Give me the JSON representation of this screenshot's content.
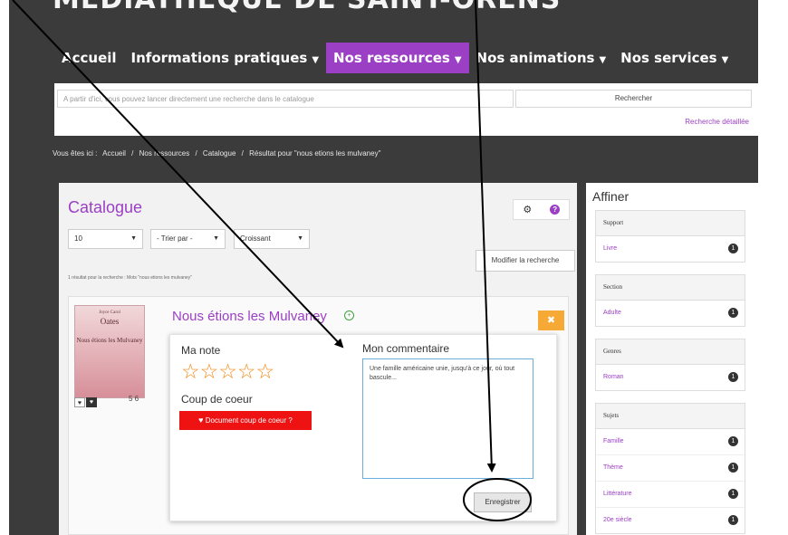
{
  "site": {
    "title": "MÉDIATHÈQUE DE SAINT-ORENS"
  },
  "nav": {
    "items": [
      {
        "label": "Accueil"
      },
      {
        "label": "Informations pratiques"
      },
      {
        "label": "Nos ressources"
      },
      {
        "label": "Nos animations"
      },
      {
        "label": "Nos services"
      }
    ],
    "caret": "▼"
  },
  "search": {
    "placeholder": "A partir d'ici, vous pouvez lancer directement une recherche dans le catalogue",
    "button_label": "Rechercher",
    "advanced_link": "Recherche détaillée"
  },
  "breadcrumb": {
    "prefix": "Vous êtes ici :",
    "items": [
      "Accueil",
      "Nos ressources",
      "Catalogue",
      "Résultat pour \"nous etions les mulvaney\""
    ],
    "separator": "/"
  },
  "catalogue": {
    "title": "Catalogue",
    "per_page": "10",
    "sort": "- Trier par -",
    "order": "Croissant",
    "modify_button": "Modifier la recherche",
    "results_text": "1 résultat pour la recherche : Mots \"nous etions les mulvaney\""
  },
  "result": {
    "title": "Nous étions les Mulvaney",
    "book_author_first": "Joyce Carol",
    "book_author_last": "Oates",
    "book_title": "Nous étions les Mulvaney",
    "year": "5 6"
  },
  "popup": {
    "rating_label": "Ma note",
    "stars": "☆☆☆☆☆",
    "favorite_label": "Coup de coeur",
    "favorite_button": "Document coup de coeur ?",
    "comment_label": "Mon commentaire",
    "comment_text": "Une famille américaine unie, jusqu'à ce jour, où tout bascule...",
    "save_button": "Enregistrer"
  },
  "refine": {
    "title": "Affiner",
    "facets": [
      {
        "heading": "Support",
        "items": [
          {
            "label": "Livre",
            "count": "1"
          }
        ]
      },
      {
        "heading": "Section",
        "items": [
          {
            "label": "Adulte",
            "count": "1"
          }
        ]
      },
      {
        "heading": "Genres",
        "items": [
          {
            "label": "Roman",
            "count": "1"
          }
        ]
      },
      {
        "heading": "Sujets",
        "items": [
          {
            "label": "Famille",
            "count": "1"
          },
          {
            "label": "Thème",
            "count": "1"
          },
          {
            "label": "Littérature",
            "count": "1"
          },
          {
            "label": "20e siècle",
            "count": "1"
          }
        ]
      }
    ]
  },
  "colors": {
    "accent": "#9b3fc4",
    "star": "#f28a18",
    "favorite": "#ee1212",
    "close": "#f7a935",
    "header_bg": "#3b3b3b"
  }
}
